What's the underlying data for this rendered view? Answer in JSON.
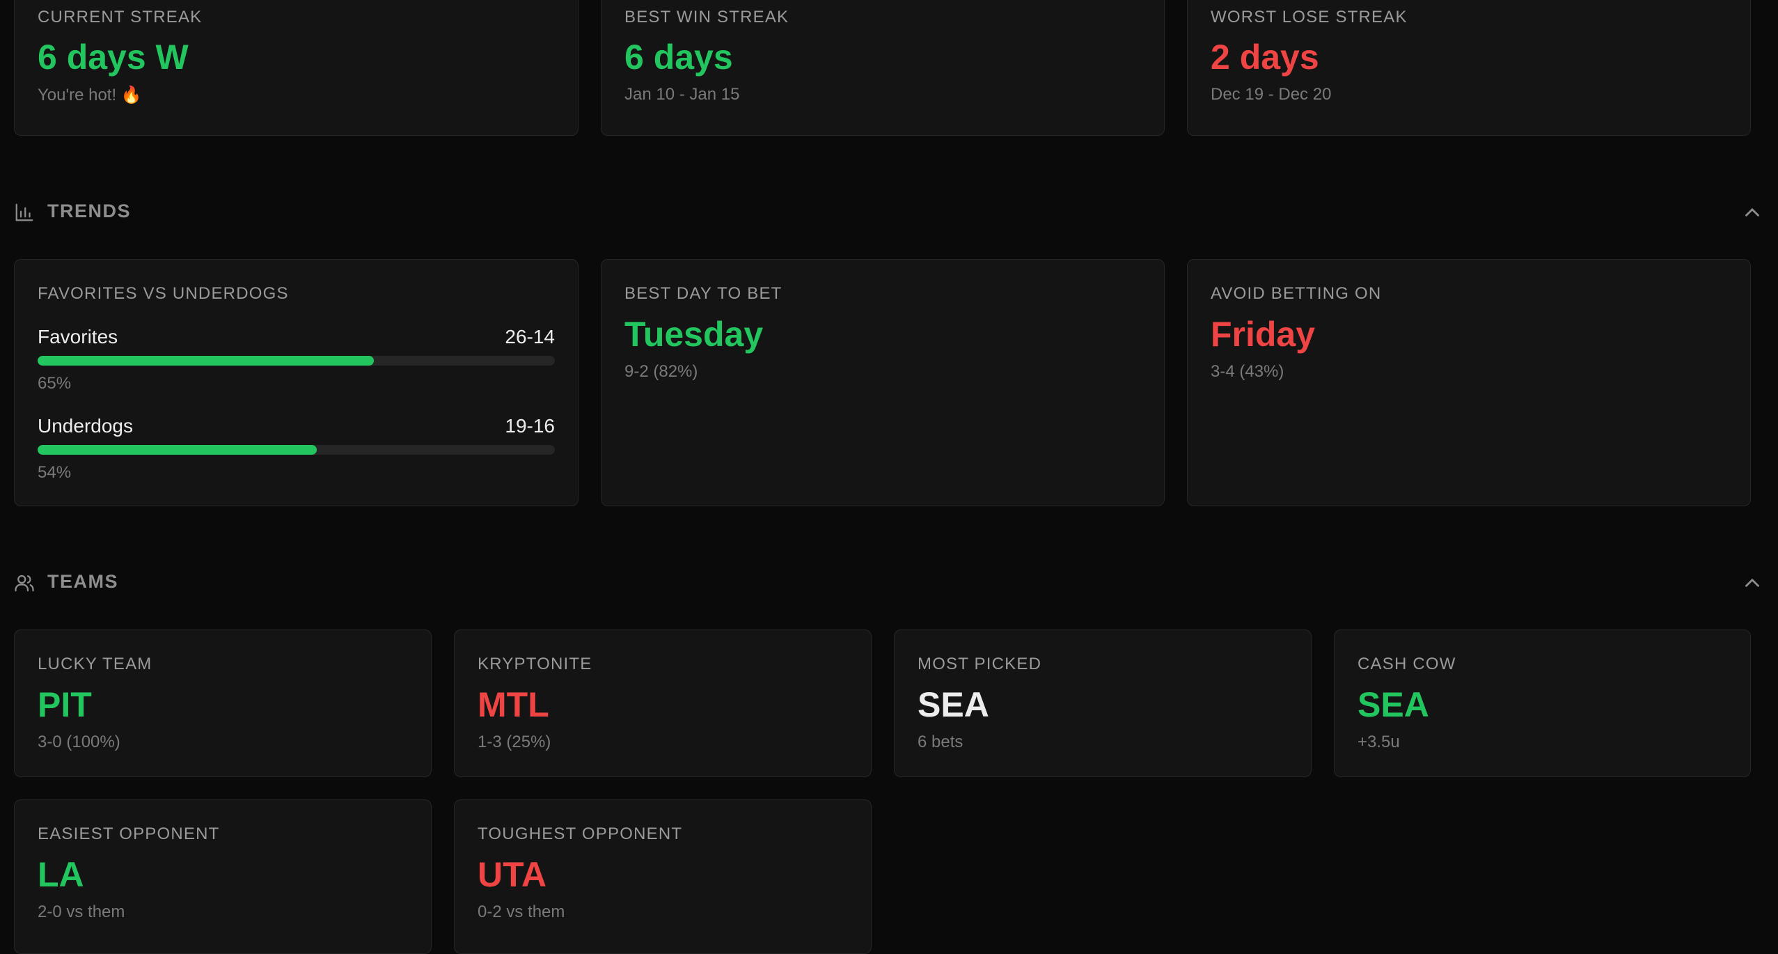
{
  "streaks": {
    "current": {
      "label": "CURRENT STREAK",
      "value": "6 days W",
      "note": "You're hot! 🔥"
    },
    "best_win": {
      "label": "BEST WIN STREAK",
      "value": "6 days",
      "note": "Jan 10 - Jan 15"
    },
    "worst_lose": {
      "label": "WORST LOSE STREAK",
      "value": "2 days",
      "note": "Dec 19 - Dec 20"
    }
  },
  "trends": {
    "title": "TRENDS",
    "icon": "bar-chart-icon",
    "fav_vs_dog": {
      "label": "FAVORITES VS UNDERDOGS",
      "rows": [
        {
          "name": "Favorites",
          "record": "26-14",
          "percent_text": "65%",
          "fill_percent": 65
        },
        {
          "name": "Underdogs",
          "record": "19-16",
          "percent_text": "54%",
          "fill_percent": 54
        }
      ]
    },
    "best_day": {
      "label": "BEST DAY TO BET",
      "value": "Tuesday",
      "note": "9-2 (82%)"
    },
    "avoid_day": {
      "label": "AVOID BETTING ON",
      "value": "Friday",
      "note": "3-4 (43%)"
    }
  },
  "teams": {
    "title": "TEAMS",
    "icon": "users-icon",
    "cards": [
      {
        "label": "LUCKY TEAM",
        "value": "PIT",
        "note": "3-0 (100%)",
        "tone": "green"
      },
      {
        "label": "KRYPTONITE",
        "value": "MTL",
        "note": "1-3 (25%)",
        "tone": "red"
      },
      {
        "label": "MOST PICKED",
        "value": "SEA",
        "note": "6 bets",
        "tone": "white"
      },
      {
        "label": "CASH COW",
        "value": "SEA",
        "note": "+3.5u",
        "tone": "green"
      },
      {
        "label": "EASIEST OPPONENT",
        "value": "LA",
        "note": "2-0 vs them",
        "tone": "green"
      },
      {
        "label": "TOUGHEST OPPONENT",
        "value": "UTA",
        "note": "0-2 vs them",
        "tone": "red"
      }
    ]
  },
  "colors": {
    "background": "#0a0a0a",
    "card": "#141414",
    "border": "#262626",
    "positive": "#22c55e",
    "negative": "#ef4444",
    "muted": "#7a7a7a"
  }
}
